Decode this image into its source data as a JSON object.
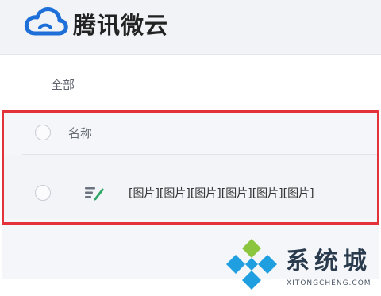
{
  "header": {
    "logo_icon": "cloud-logo-icon",
    "app_title": "腾讯微云",
    "brand_color": "#1e6fd8"
  },
  "breadcrumb": {
    "label": "全部"
  },
  "file_list": {
    "columns": [
      {
        "label": "名称"
      }
    ],
    "rows": [
      {
        "icon": "document-edit-icon",
        "name": "[图片][图片][图片][图片][图片][图片]"
      }
    ],
    "highlight_color": "#e3323a"
  },
  "watermark": {
    "icon": "site-logo-icon",
    "text": "系统城",
    "url": "XITONGCHENG.COM",
    "colors": [
      "#1f9ee0",
      "#8cc63f"
    ]
  }
}
